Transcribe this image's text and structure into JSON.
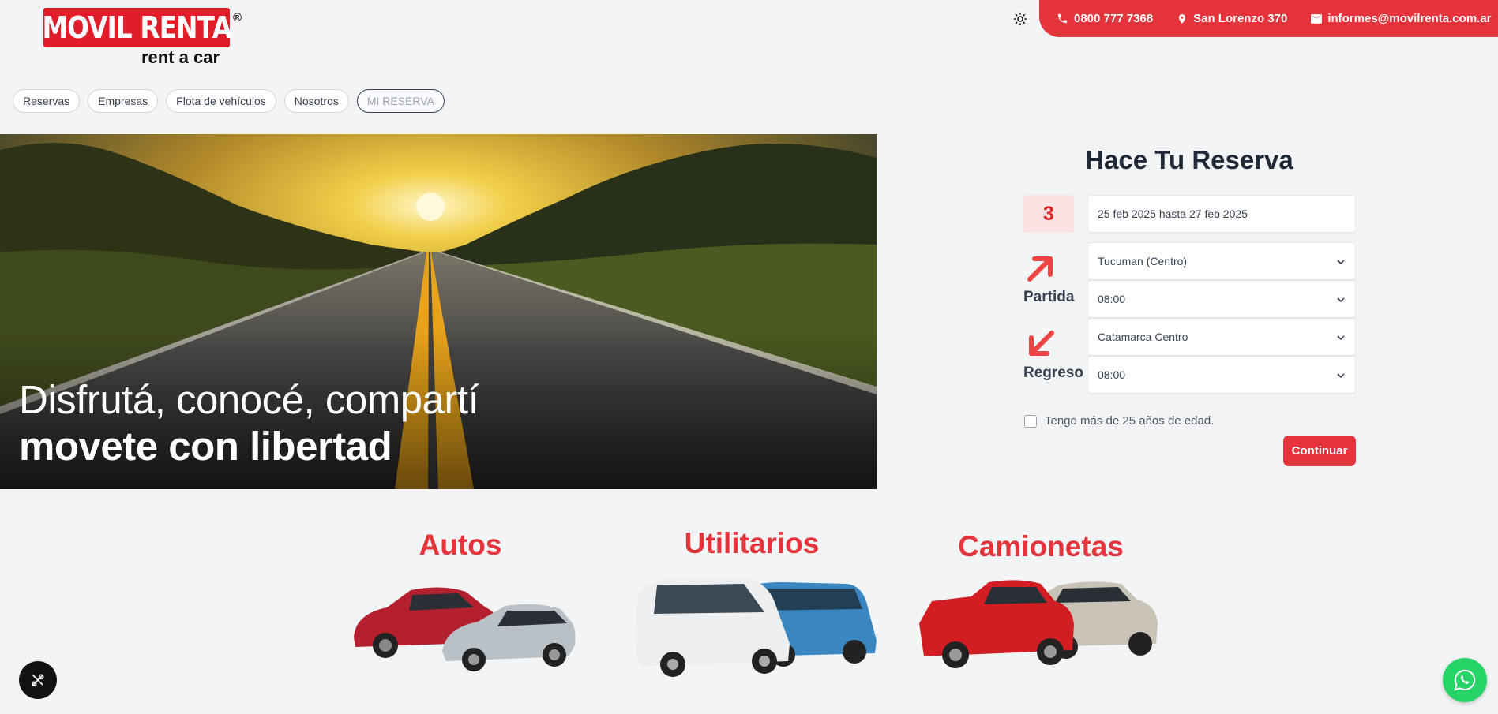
{
  "brand": {
    "logo_text": "MOVIL RENTA",
    "logo_reg": "®",
    "logo_sub": "rent a car",
    "accent_color": "#e5343c"
  },
  "contact": {
    "phone": "0800 777 7368",
    "address": "San Lorenzo 370",
    "email": "informes@movilrenta.com.ar",
    "icons": [
      "phone-icon",
      "location-pin-icon",
      "mail-icon"
    ]
  },
  "nav": {
    "items": [
      "Reservas",
      "Empresas",
      "Flota de vehículos",
      "Nosotros",
      "MI RESERVA"
    ]
  },
  "hero": {
    "line1": "Disfrutá, conocé, compartí",
    "line2": "movete con libertad"
  },
  "reservation": {
    "title": "Hace Tu Reserva",
    "days": "3",
    "date_range": "25 feb 2025 hasta 27 feb 2025",
    "departure": {
      "label": "Partida",
      "location": "Tucuman (Centro)",
      "time": "08:00"
    },
    "return": {
      "label": "Regreso",
      "location": "Catamarca Centro",
      "time": "08:00"
    },
    "age_check": {
      "label": "Tengo más de 25 años de edad.",
      "checked": false
    },
    "continue_label": "Continuar"
  },
  "categories": [
    "Autos",
    "Utilitarios",
    "Camionetas"
  ]
}
